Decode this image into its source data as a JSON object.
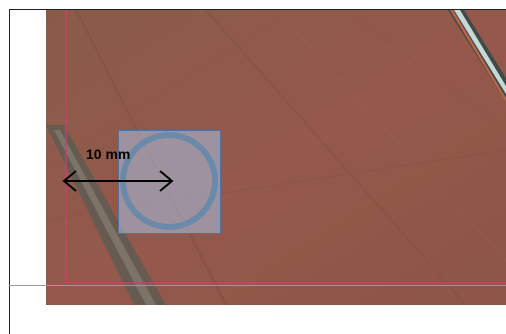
{
  "scale_bar": {
    "label": "10 mm"
  },
  "colors": {
    "page_background": "#ffffff",
    "specimen_background": "#8f5848",
    "crop_border": "#d43a6a",
    "roi_fill": "#a5b4d2",
    "roi_border": "#56709e",
    "circle_stroke": "#6b8aa9",
    "edge_highlight": "#c7d9d4"
  },
  "icons": {
    "scale_arrow": "double-headed-arrow"
  }
}
